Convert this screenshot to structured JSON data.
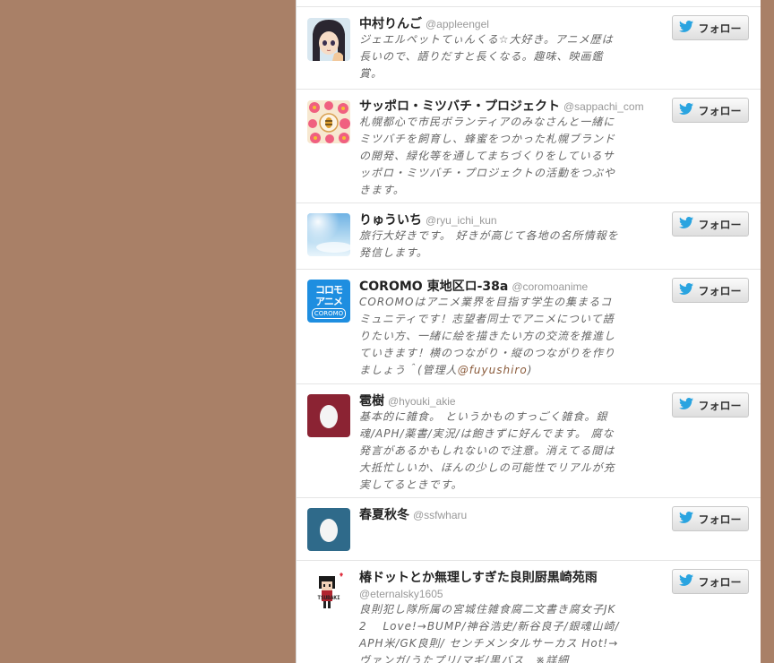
{
  "colors": {
    "background": "#a98067",
    "twitter_blue": "#2aa4e0",
    "handle_gray": "#999999",
    "bio_gray": "#666666"
  },
  "follow_label": "フォロー",
  "users": [
    {
      "name": "中村りんご",
      "handle": "@appleengel",
      "bio": "ジェエルペットてぃんくる☆大好き。アニメ歴は長いので、語りだすと長くなる。趣味、映画鑑賞。",
      "avatar_icon": "anime-character-avatar"
    },
    {
      "name": "サッポロ・ミツバチ・プロジェクト",
      "handle": "@sappachi_com",
      "bio": "札幌都心で市民ボランティアのみなさんと一緒にミツバチを飼育し、蜂蜜をつかった札幌ブランドの開発、緑化等を通してまちづくりをしているサッポロ・ミツバチ・プロジェクトの活動をつぶやきます。",
      "avatar_icon": "flower-pattern-avatar"
    },
    {
      "name": "りゅういち",
      "handle": "@ryu_ichi_kun",
      "bio": "旅行大好きです。 好きが高じて各地の名所情報を発信します。",
      "avatar_icon": "sky-avatar"
    },
    {
      "name": "COROMO 東地区ロ-38a",
      "handle": "@coromoanime",
      "bio_before": "COROMOはアニメ業界を目指す学生の集まるコミュニティです！志望者同士でアニメについて語りたい方、一緒に絵を描きたい方の交流を推進していきます！横のつながり・縦のつながりを作りましょう＾(管理人",
      "bio_mention": "@fuyushiro",
      "bio_after": ")",
      "avatar_text_1": "コロモ",
      "avatar_text_2": "アニメ",
      "avatar_text_3": "COROMO"
    },
    {
      "name": "雹樹",
      "handle": "@hyouki_akie",
      "bio": "基本的に雑食。 というかものすっごく雑食。銀魂/APH/薬書/実況/は飽きずに好んでます。 腐な発言があるかもしれないので注意。消えてる間は大抵忙しいか、ほんの少しの可能性でリアルが充実してるときです。",
      "avatar_icon": "default-egg-avatar"
    },
    {
      "name": "春夏秋冬",
      "handle": "@ssfwharu",
      "bio": "",
      "avatar_icon": "default-egg-avatar"
    },
    {
      "name": "椿ドットとか無理しすぎた良則厨黒崎苑雨",
      "handle": "@eternalsky1605",
      "bio": "良則犯し隊所属の宮城住雑食腐二文書き腐女子JK2　 Love!→BUMP/神谷浩史/新谷良子/銀魂山崎/APH米/GK良則/ センチメンタルサーカス Hot!→ヴァンガ/うたプリ/マギ/黒バス　※詳細",
      "avatar_text_1": "TSUBAKI"
    }
  ]
}
